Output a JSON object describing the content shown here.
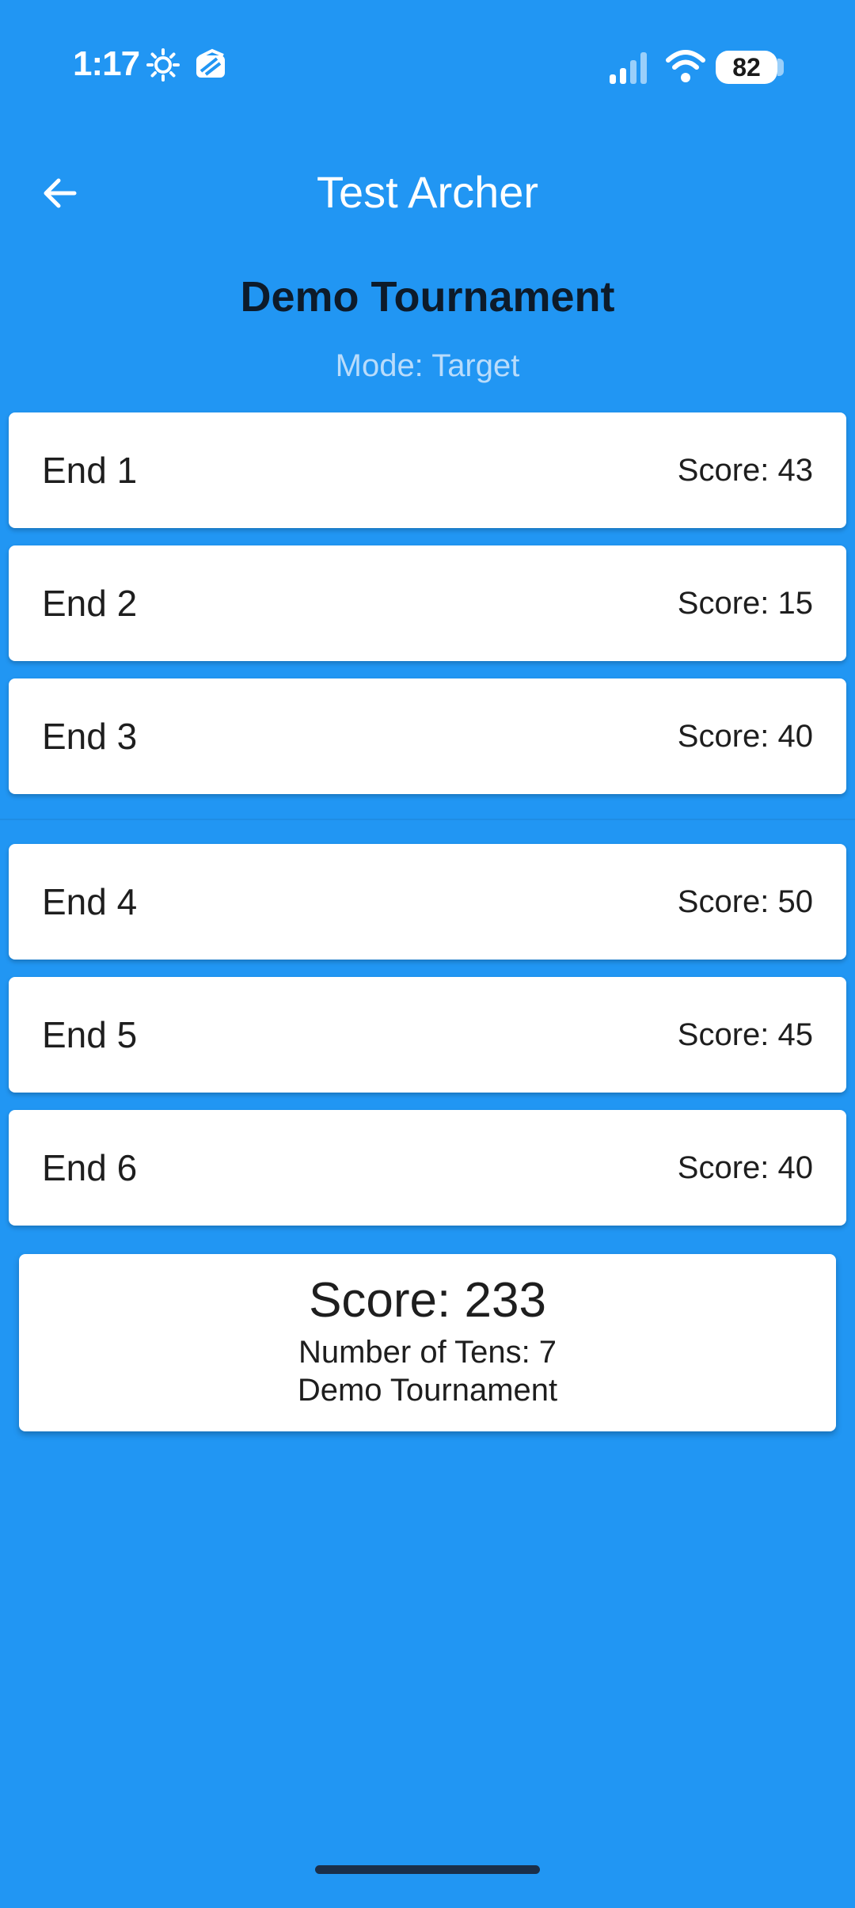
{
  "status_bar": {
    "time": "1:17",
    "battery": "82",
    "icons": [
      "brightness-icon",
      "stack-app-icon",
      "signal-icon",
      "wifi-icon",
      "battery-icon"
    ]
  },
  "app_bar": {
    "title": "Test Archer",
    "back_icon": "arrow-left-icon"
  },
  "tournament": {
    "name": "Demo Tournament",
    "mode": "Mode: Target"
  },
  "ends": [
    {
      "label": "End 1",
      "score": "Score: 43"
    },
    {
      "label": "End 2",
      "score": "Score: 15"
    },
    {
      "label": "End 3",
      "score": "Score: 40"
    },
    {
      "label": "End 4",
      "score": "Score: 50"
    },
    {
      "label": "End 5",
      "score": "Score: 45"
    },
    {
      "label": "End 6",
      "score": "Score: 40"
    }
  ],
  "summary": {
    "score": "Score: 233",
    "tens": "Number of Tens: 7",
    "tournament": "Demo Tournament"
  },
  "colors": {
    "background": "#2196F3",
    "card": "#FFFFFF",
    "title_dark": "#0D1B2A",
    "mode_text": "#B9DCFB"
  }
}
